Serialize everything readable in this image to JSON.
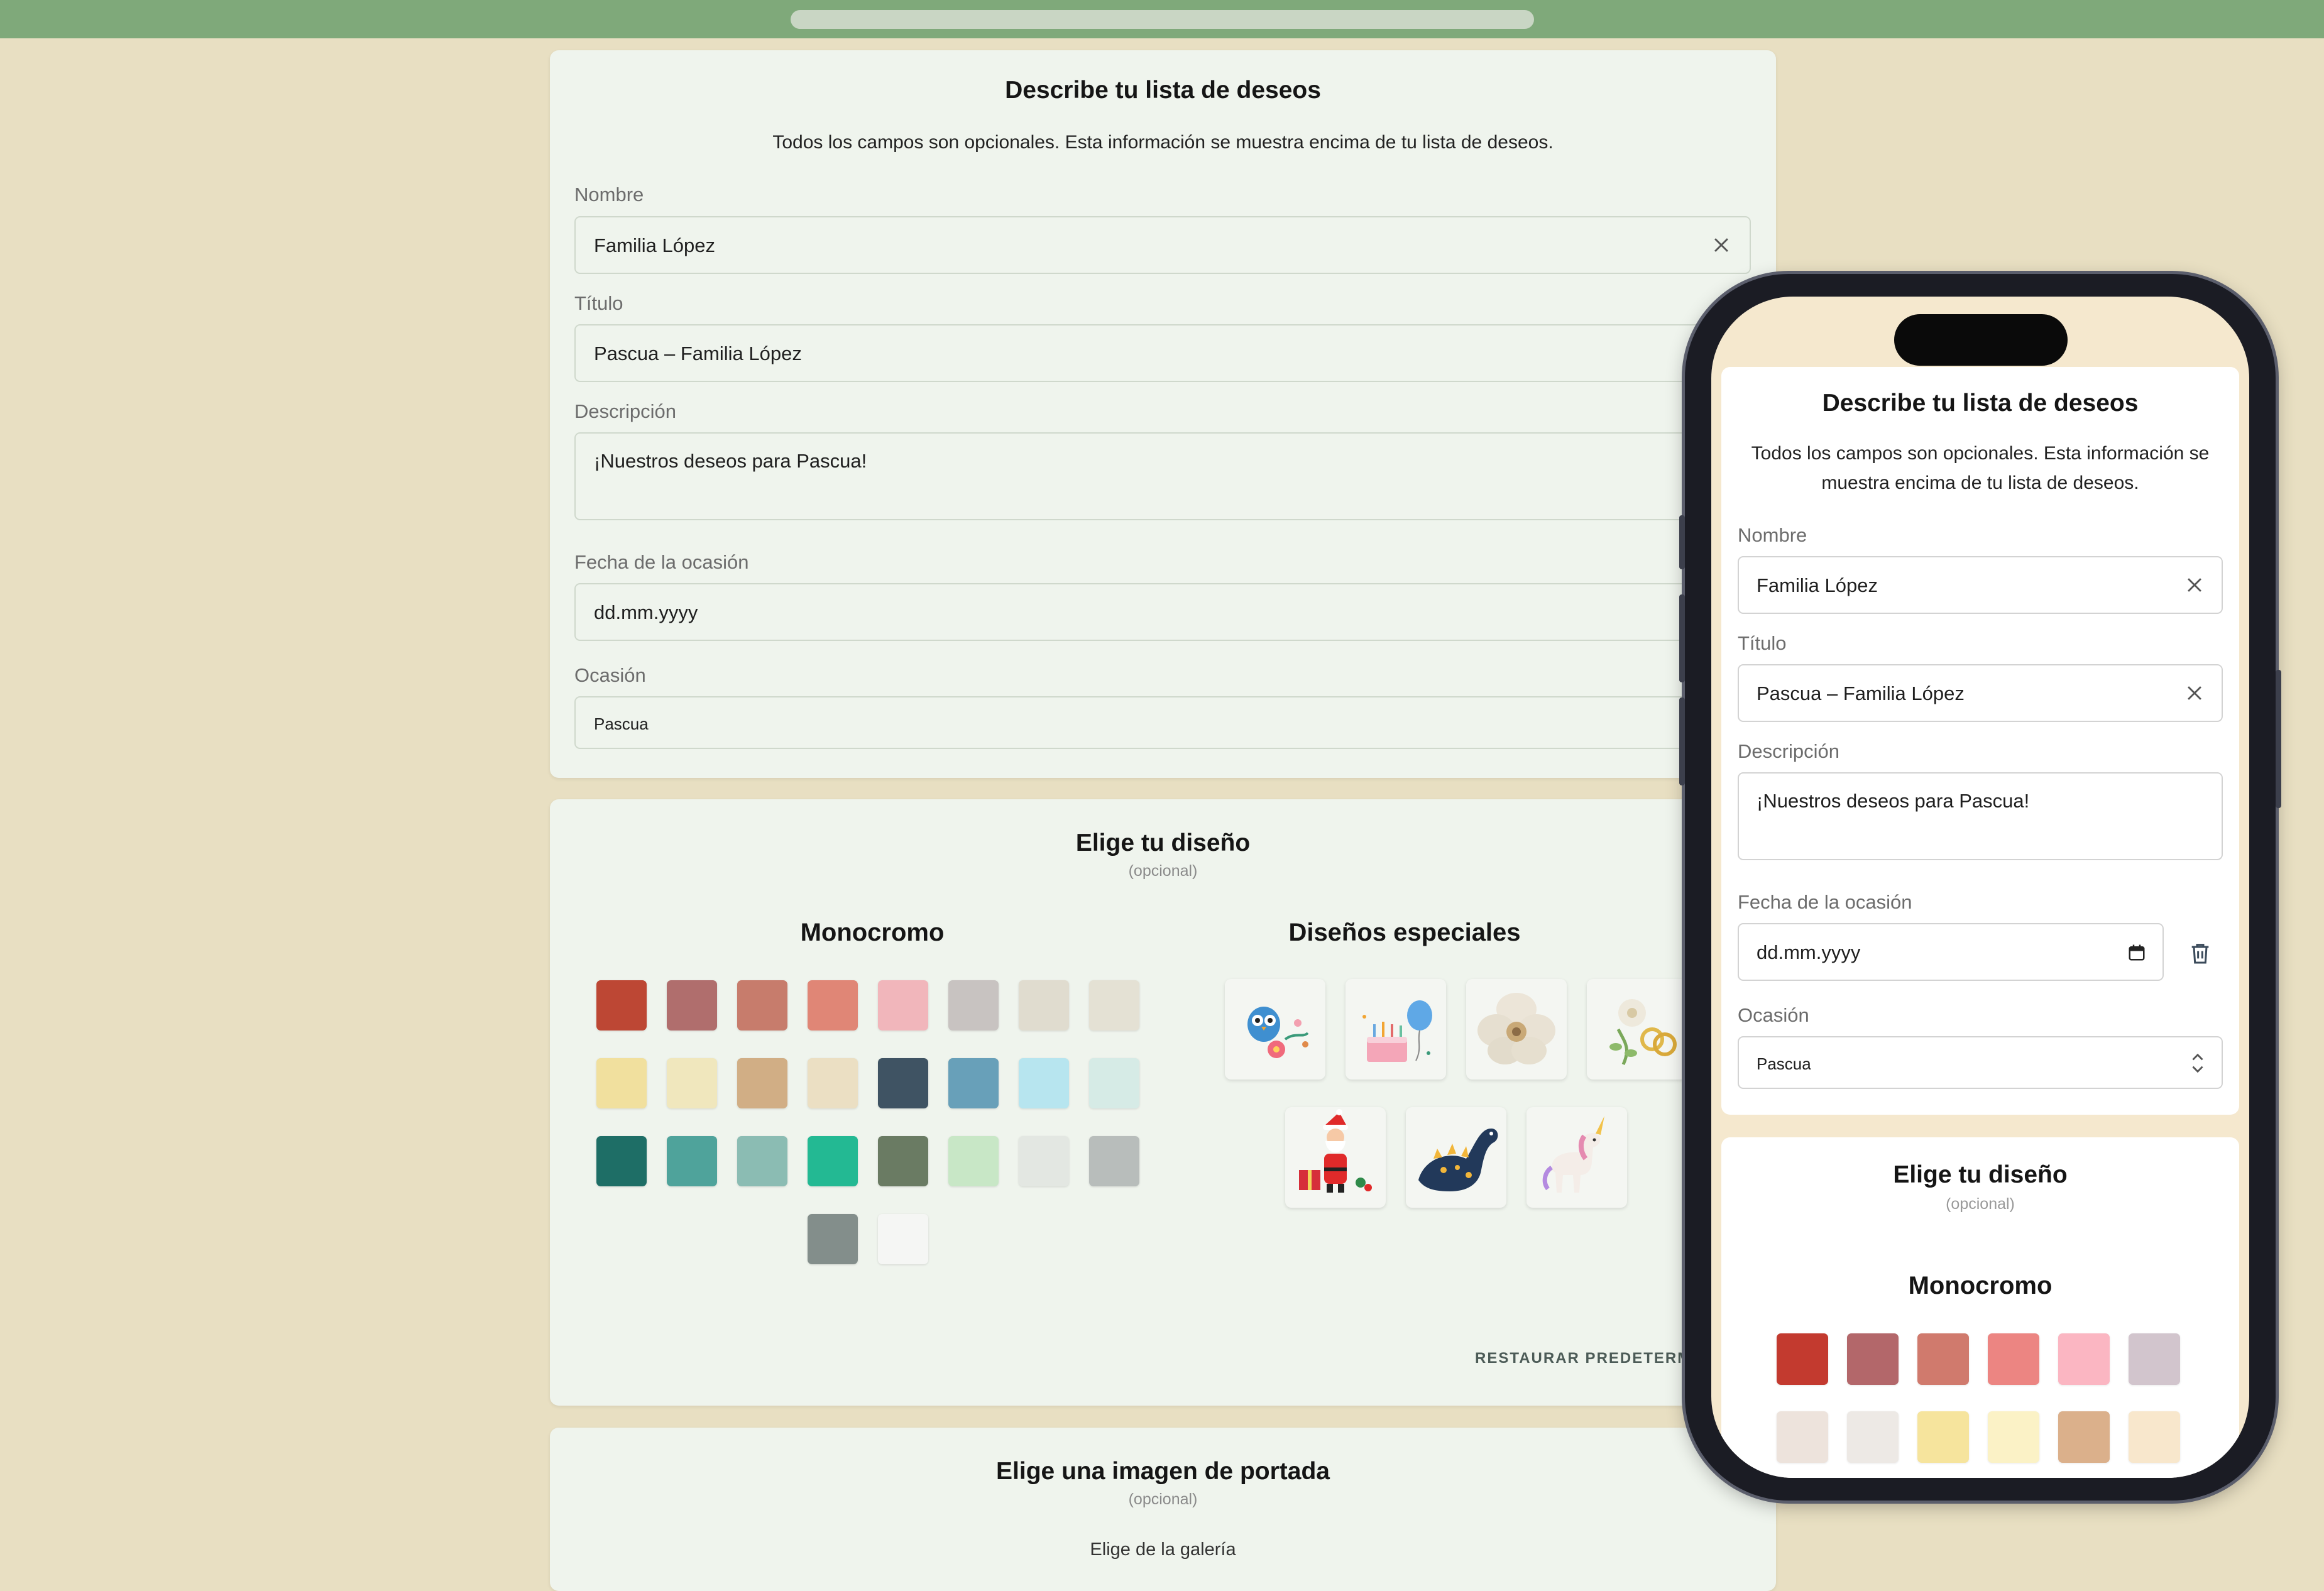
{
  "details_form": {
    "title": "Describe tu lista de deseos",
    "subtitle": "Todos los campos son opcionales. Esta información se muestra encima de tu lista de deseos.",
    "name_label": "Nombre",
    "name_value": "Familia López",
    "title_label": "Título",
    "title_value": "Pascua – Familia López",
    "description_label": "Descripción",
    "description_value": "¡Nuestros deseos para Pascua!",
    "date_label": "Fecha de la ocasión",
    "date_placeholder": "dd.mm.yyyy",
    "occasion_label": "Ocasión",
    "occasion_value": "Pascua"
  },
  "design": {
    "title": "Elige tu diseño",
    "optional": "(opcional)",
    "monochrome_title": "Monocromo",
    "special_title": "Diseños especiales",
    "reset_label": "RESTAURAR PREDETERMIN",
    "monochrome_colors": [
      "#bd4734",
      "#b06e6d",
      "#c77c6c",
      "#e08676",
      "#f1b6bb",
      "#c8c3c1",
      "#e0dccf",
      "#e4e1d4",
      "#f1e09e",
      "#f0e7bd",
      "#d1ae85",
      "#ebdfc3",
      "#3f5363",
      "#68a0b9",
      "#b7e5ef",
      "#d6ebe6",
      "#1e6e66",
      "#4fa39b",
      "#8bbcb3",
      "#23b993",
      "#6a7b63",
      "#c8e7c6",
      "#e3e7e2",
      "#b8bdbb",
      "#838e8b",
      "#f5f6f4"
    ],
    "special_designs": [
      {
        "icon": "owl-flowers-icon"
      },
      {
        "icon": "birthday-cake-balloon-icon"
      },
      {
        "icon": "white-flower-icon"
      },
      {
        "icon": "wedding-rings-flowers-icon"
      },
      {
        "icon": "santa-claus-gift-icon"
      },
      {
        "icon": "dinosaur-icon"
      },
      {
        "icon": "unicorn-icon"
      }
    ]
  },
  "cover": {
    "title": "Elige una imagen de portada",
    "optional": "(opcional)",
    "gallery_label": "Elige de la galería"
  },
  "phone_preview": {
    "title": "Describe tu lista de deseos",
    "subtitle": "Todos los campos son opcionales. Esta información se muestra encima de tu lista de deseos.",
    "name_label": "Nombre",
    "name_value": "Familia López",
    "title_label": "Título",
    "title_value": "Pascua – Familia López",
    "description_label": "Descripción",
    "description_value": "¡Nuestros deseos para Pascua!",
    "date_label": "Fecha de la ocasión",
    "date_placeholder": "dd.mm.yyyy",
    "occasion_label": "Ocasión",
    "occasion_value": "Pascua",
    "design_title": "Elige tu diseño",
    "design_optional": "(opcional)",
    "monochrome_title": "Monocromo",
    "monochrome_colors": [
      "#c33a2f",
      "#b3676a",
      "#d07a6d",
      "#ec8582",
      "#fbb6c2",
      "#d2c5cd",
      "#ede3dc",
      "#ede9e5",
      "#f6e49d",
      "#fbf2c6",
      "#dbb08b",
      "#f8e7cc"
    ]
  }
}
